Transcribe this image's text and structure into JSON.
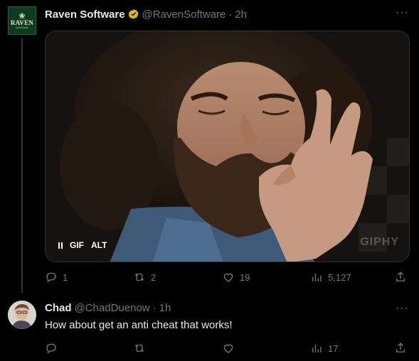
{
  "tweet": {
    "author_name": "Raven Software",
    "handle": "@RavenSoftware",
    "separator": "·",
    "time": "2h",
    "avatar_text": "RAVEN",
    "avatar_subtext": "SOFTWARE",
    "more_label": "···",
    "media": {
      "gif_label": "GIF",
      "alt_label": "ALT",
      "watermark": "GIPHY"
    },
    "actions": {
      "replies": "1",
      "retweets": "2",
      "likes": "19",
      "views": "5,127"
    }
  },
  "reply": {
    "author_name": "Chad",
    "handle": "@ChadDuenow",
    "separator": "·",
    "time": "1h",
    "text": "How about get an anti cheat that works!",
    "more_label": "···",
    "actions": {
      "views": "17"
    }
  },
  "colors": {
    "background": "#000000",
    "text": "#e7e9ea",
    "muted": "#71767b",
    "verified_gold": "#e2b719"
  }
}
